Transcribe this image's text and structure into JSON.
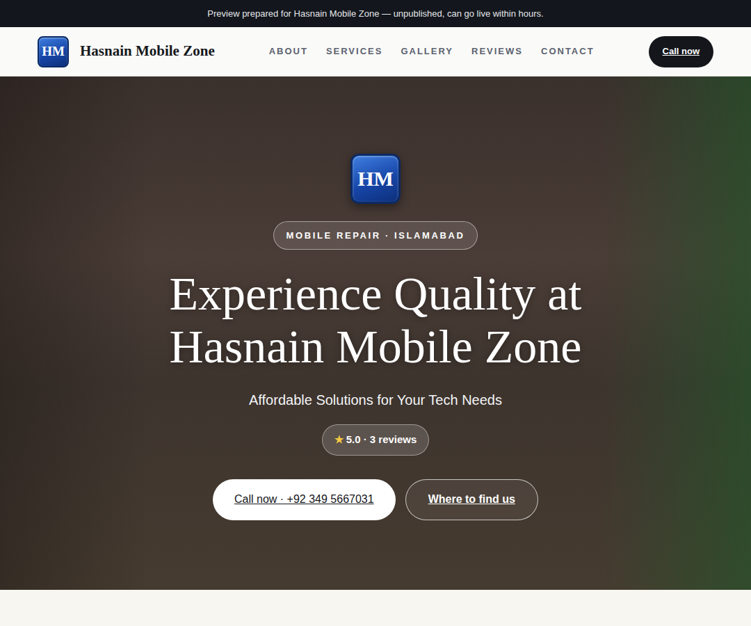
{
  "banner": "Preview prepared for Hasnain Mobile Zone — unpublished, can go live within hours.",
  "header": {
    "logo": "HM",
    "brand": "Hasnain Mobile Zone",
    "nav": [
      {
        "label": "ABOUT",
        "selected": false
      },
      {
        "label": "SERVICES",
        "selected": false
      },
      {
        "label": "GALLERY",
        "selected": false
      },
      {
        "label": "REVIEWS",
        "selected": false
      },
      {
        "label": "CONTACT",
        "selected": false
      }
    ],
    "cta": "Call now"
  },
  "hero": {
    "logo": "HM",
    "tag": "MOBILE REPAIR · ISLAMABAD",
    "title_lines": [
      "Experience Quality at",
      "Hasnain Mobile Zone"
    ],
    "subtitle": "Affordable Solutions for Your Tech Needs",
    "rating": {
      "star": "★",
      "text": "5.0 · 3 reviews"
    },
    "buttons": [
      "Call now · +92 349 5667031",
      "Where to find us"
    ]
  }
}
